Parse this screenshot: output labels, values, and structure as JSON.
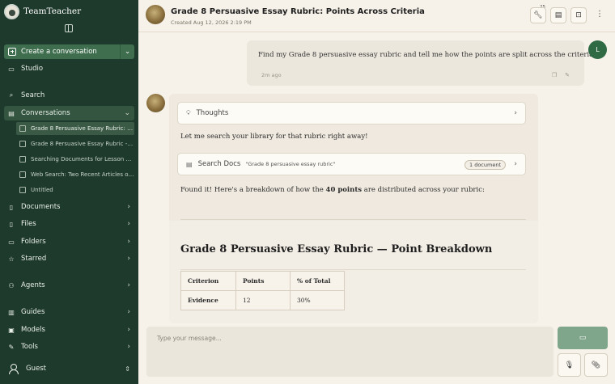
{
  "sidebar": {
    "app_name": "TeamTeacher",
    "create_label": "Create a conversation",
    "studio_label": "Studio",
    "search_label": "Search",
    "conversations_label": "Conversations",
    "conversations": [
      "Grade 8 Persuasive Essay Rubric: Poi...",
      "Grade 8 Persuasive Essay Rubric - Po...",
      "Searching Documents for Lesson Pla...",
      "Web Search: Two Recent Articles on ...",
      "Untitled"
    ],
    "documents_label": "Documents",
    "files_label": "Files",
    "folders_label": "Folders",
    "starred_label": "Starred",
    "agents_label": "Agents",
    "guides_label": "Guides",
    "models_label": "Models",
    "tools_label": "Tools",
    "user_label": "Guest"
  },
  "header": {
    "title": "Grade 8 Persuasive Essay Rubric: Points Across Criteria",
    "subtitle": "Created Aug 12, 2026 2:19 PM",
    "badge_count": "25"
  },
  "chat": {
    "user_message": "Find my Grade 8 persuasive essay rubric and tell me how the points are split across the criteria.",
    "user_time": "2m ago",
    "user_initial": "L",
    "thoughts_label": "Thoughts",
    "intro_text": "Let me search your library for that rubric right away!",
    "search_label": "Search Docs",
    "search_query": "\"Grade 8 persuasive essay rubric\"",
    "search_result_count": "1 document",
    "found_prefix": "Found it! Here's a breakdown of how the ",
    "found_bold": "40 points",
    "found_suffix": " are distributed across your rubric:",
    "doc_heading": "Grade 8 Persuasive Essay Rubric — Point Breakdown",
    "table": {
      "headers": [
        "Criterion",
        "Points",
        "% of Total"
      ],
      "rows": [
        [
          "Evidence",
          "12",
          "30%"
        ]
      ]
    }
  },
  "input": {
    "placeholder": "Type your message..."
  }
}
